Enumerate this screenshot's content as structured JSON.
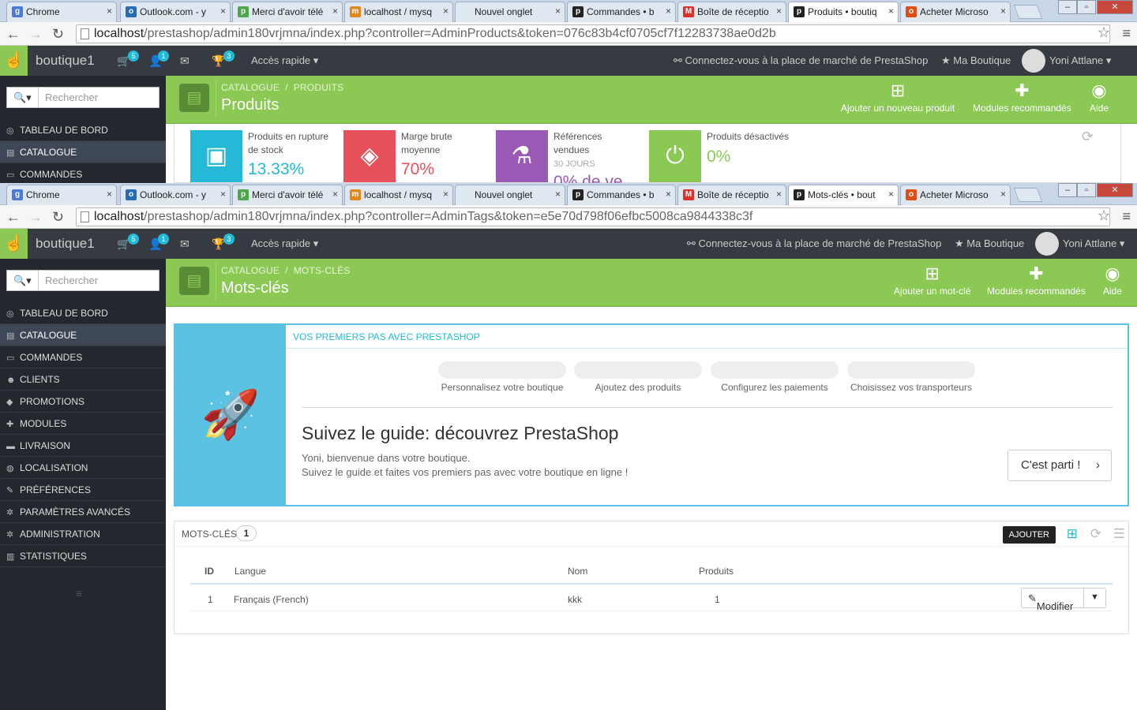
{
  "window1": {
    "tabs": [
      {
        "label": "Chrome",
        "fav": "g",
        "color": "#4a7bd4"
      },
      {
        "label": "Outlook.com - y",
        "fav": "o",
        "color": "#2a6bb5"
      },
      {
        "label": "Merci d'avoir télé",
        "fav": "p",
        "color": "#4aa84a"
      },
      {
        "label": "localhost / mysq",
        "fav": "m",
        "color": "#e08a1e"
      },
      {
        "label": "Nouvel onglet",
        "fav": "",
        "color": "#dfe7f1"
      },
      {
        "label": "Commandes • b",
        "fav": "p",
        "color": "#222222"
      },
      {
        "label": "Boîte de réceptio",
        "fav": "M",
        "color": "#d9342b"
      },
      {
        "label": "Produits • boutiq",
        "fav": "p",
        "color": "#222222"
      },
      {
        "label": "Acheter Microso",
        "fav": "o",
        "color": "#e04d17"
      }
    ],
    "url_host": "localhost",
    "url_rest": "/prestashop/admin180vrjmna/index.php?controller=AdminProducts&token=076c83b4cf0705cf7f12283738ae0d2b",
    "breadcrumb_1": "CATALOGUE",
    "breadcrumb_2": "PRODUITS",
    "title": "Produits",
    "toolbar": [
      {
        "label": "Ajouter un nouveau produit",
        "icon": "plus-icon"
      },
      {
        "label": "Modules recommandés",
        "icon": "puzzle-icon"
      },
      {
        "label": "Aide",
        "icon": "lifebuoy-icon"
      }
    ],
    "kpis": [
      {
        "label_1": "Produits en rupture",
        "label_2": "de stock",
        "value": "13.33%",
        "color": "#25b9d7",
        "icon": "archive-icon"
      },
      {
        "label_1": "Marge brute",
        "label_2": "moyenne",
        "value": "70%",
        "color": "#e7505a",
        "icon": "tags-icon"
      },
      {
        "label_1": "Références",
        "label_2": "vendues",
        "sub": "30 JOURS",
        "value": "0% de ve",
        "color": "#9b59b6",
        "icon": "flask-icon"
      },
      {
        "label_1": "Produits désactivés",
        "label_2": "",
        "value": "0%",
        "color": "#8bc954",
        "icon": "power-icon"
      }
    ]
  },
  "window2": {
    "tabs": [
      {
        "label": "Chrome",
        "fav": "g",
        "color": "#4a7bd4"
      },
      {
        "label": "Outlook.com - y",
        "fav": "o",
        "color": "#2a6bb5"
      },
      {
        "label": "Merci d'avoir télé",
        "fav": "p",
        "color": "#4aa84a"
      },
      {
        "label": "localhost / mysq",
        "fav": "m",
        "color": "#e08a1e"
      },
      {
        "label": "Nouvel onglet",
        "fav": "",
        "color": "#dfe7f1"
      },
      {
        "label": "Commandes • b",
        "fav": "p",
        "color": "#222222"
      },
      {
        "label": "Boîte de réceptio",
        "fav": "M",
        "color": "#d9342b"
      },
      {
        "label": "Mots-clés • bout",
        "fav": "p",
        "color": "#222222"
      },
      {
        "label": "Acheter Microso",
        "fav": "o",
        "color": "#e04d17"
      }
    ],
    "url_host": "localhost",
    "url_rest": "/prestashop/admin180vrjmna/index.php?controller=AdminTags&token=e5e70d798f06efbc5008ca9844338c3f",
    "breadcrumb_1": "CATALOGUE",
    "breadcrumb_2": "MOTS-CLÉS",
    "title": "Mots-clés",
    "toolbar": [
      {
        "label": "Ajouter un mot-clé",
        "icon": "plus-icon"
      },
      {
        "label": "Modules recommandés",
        "icon": "puzzle-icon"
      },
      {
        "label": "Aide",
        "icon": "lifebuoy-icon"
      }
    ]
  },
  "header": {
    "shop_name": "boutique1",
    "badge_orders": "5",
    "badge_customers": "1",
    "badge_trophy": "3",
    "quick_access": "Accès rapide",
    "marketplace": "Connectez-vous à la place de marché de PrestaShop",
    "my_shop": "Ma Boutique",
    "user": "Yoni Attlane"
  },
  "search": {
    "placeholder": "Rechercher"
  },
  "menu": [
    {
      "label": "TABLEAU DE BORD",
      "icon": "dashboard-icon",
      "glyph": "◎"
    },
    {
      "label": "CATALOGUE",
      "icon": "book-icon",
      "glyph": "▤"
    },
    {
      "label": "COMMANDES",
      "icon": "credit-card-icon",
      "glyph": "▭"
    },
    {
      "label": "CLIENTS",
      "icon": "users-icon",
      "glyph": "☻"
    },
    {
      "label": "PROMOTIONS",
      "icon": "tags-icon",
      "glyph": "◆"
    },
    {
      "label": "MODULES",
      "icon": "puzzle-icon",
      "glyph": "✚"
    },
    {
      "label": "LIVRAISON",
      "icon": "truck-icon",
      "glyph": "▬"
    },
    {
      "label": "LOCALISATION",
      "icon": "globe-icon",
      "glyph": "◍"
    },
    {
      "label": "PRÉFÉRENCES",
      "icon": "wrench-icon",
      "glyph": "✎"
    },
    {
      "label": "PARAMÈTRES AVANCÉS",
      "icon": "cogs-icon",
      "glyph": "✲"
    },
    {
      "label": "ADMINISTRATION",
      "icon": "cog-icon",
      "glyph": "✲"
    },
    {
      "label": "STATISTIQUES",
      "icon": "bar-chart-icon",
      "glyph": "▥"
    }
  ],
  "guide": {
    "heading": "VOS PREMIERS PAS AVEC PRESTASHOP",
    "steps": [
      "Personnalisez votre boutique",
      "Ajoutez des produits",
      "Configurez les paiements",
      "Choisissez vos transporteurs"
    ],
    "title": "Suivez le guide: découvrez PrestaShop",
    "line_1": "Yoni, bienvenue dans votre boutique.",
    "line_2": "Suivez le guide et faites vos premiers pas avec votre boutique en ligne !",
    "button": "C'est parti !"
  },
  "tags_panel": {
    "title": "MOTS-CLÉS",
    "count": "1",
    "tooltip": "AJOUTER",
    "columns": [
      "ID",
      "Langue",
      "Nom",
      "Produits"
    ],
    "rows": [
      {
        "id": "1",
        "langue": "Français (French)",
        "nom": "kkk",
        "produits": "1"
      }
    ],
    "edit_label": "Modifier"
  }
}
